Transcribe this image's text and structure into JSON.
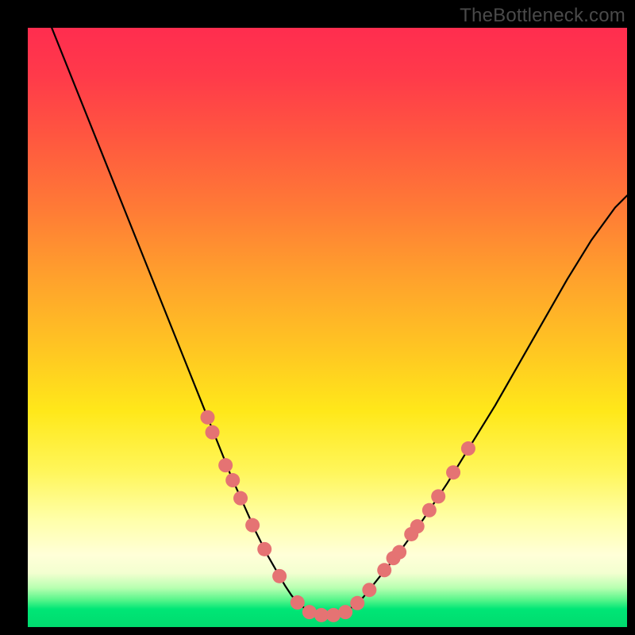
{
  "attribution": "TheBottleneck.com",
  "chart_data": {
    "type": "line",
    "title": "",
    "xlabel": "",
    "ylabel": "",
    "xlim": [
      0,
      100
    ],
    "ylim": [
      0,
      100
    ],
    "grid": false,
    "legend": false,
    "curve": {
      "name": "bottleneck-curve",
      "color": "#000000",
      "x": [
        4,
        6,
        8,
        10,
        12,
        14,
        16,
        18,
        20,
        22,
        24,
        26,
        28,
        30,
        32,
        34,
        36,
        38,
        40,
        42,
        43,
        44,
        45,
        47,
        50,
        53,
        55,
        56,
        58,
        62,
        66,
        70,
        74,
        78,
        82,
        86,
        90,
        94,
        98,
        100
      ],
      "y": [
        100,
        95,
        90,
        85,
        80,
        75,
        70,
        65,
        60,
        55,
        50,
        45,
        40,
        35,
        30,
        25,
        20.5,
        16,
        12,
        8.5,
        6.8,
        5.3,
        4.1,
        2.5,
        2.0,
        2.5,
        4.0,
        5.0,
        7.5,
        12.5,
        18,
        24,
        30.5,
        37,
        44,
        51,
        58,
        64.5,
        70,
        72
      ]
    },
    "markers": {
      "name": "highlight-points",
      "color": "#e57373",
      "radius": 9,
      "points": [
        {
          "x": 30.0,
          "y": 35.0
        },
        {
          "x": 30.8,
          "y": 32.5
        },
        {
          "x": 33.0,
          "y": 27.0
        },
        {
          "x": 34.2,
          "y": 24.5
        },
        {
          "x": 35.5,
          "y": 21.5
        },
        {
          "x": 37.5,
          "y": 17.0
        },
        {
          "x": 39.5,
          "y": 13.0
        },
        {
          "x": 42.0,
          "y": 8.5
        },
        {
          "x": 45.0,
          "y": 4.1
        },
        {
          "x": 47.0,
          "y": 2.5
        },
        {
          "x": 49.0,
          "y": 2.0
        },
        {
          "x": 51.0,
          "y": 2.0
        },
        {
          "x": 53.0,
          "y": 2.5
        },
        {
          "x": 55.0,
          "y": 4.0
        },
        {
          "x": 57.0,
          "y": 6.2
        },
        {
          "x": 59.5,
          "y": 9.5
        },
        {
          "x": 61.0,
          "y": 11.5
        },
        {
          "x": 62.0,
          "y": 12.5
        },
        {
          "x": 64.0,
          "y": 15.5
        },
        {
          "x": 65.0,
          "y": 16.8
        },
        {
          "x": 67.0,
          "y": 19.5
        },
        {
          "x": 68.5,
          "y": 21.8
        },
        {
          "x": 71.0,
          "y": 25.8
        },
        {
          "x": 73.5,
          "y": 29.8
        }
      ]
    }
  }
}
